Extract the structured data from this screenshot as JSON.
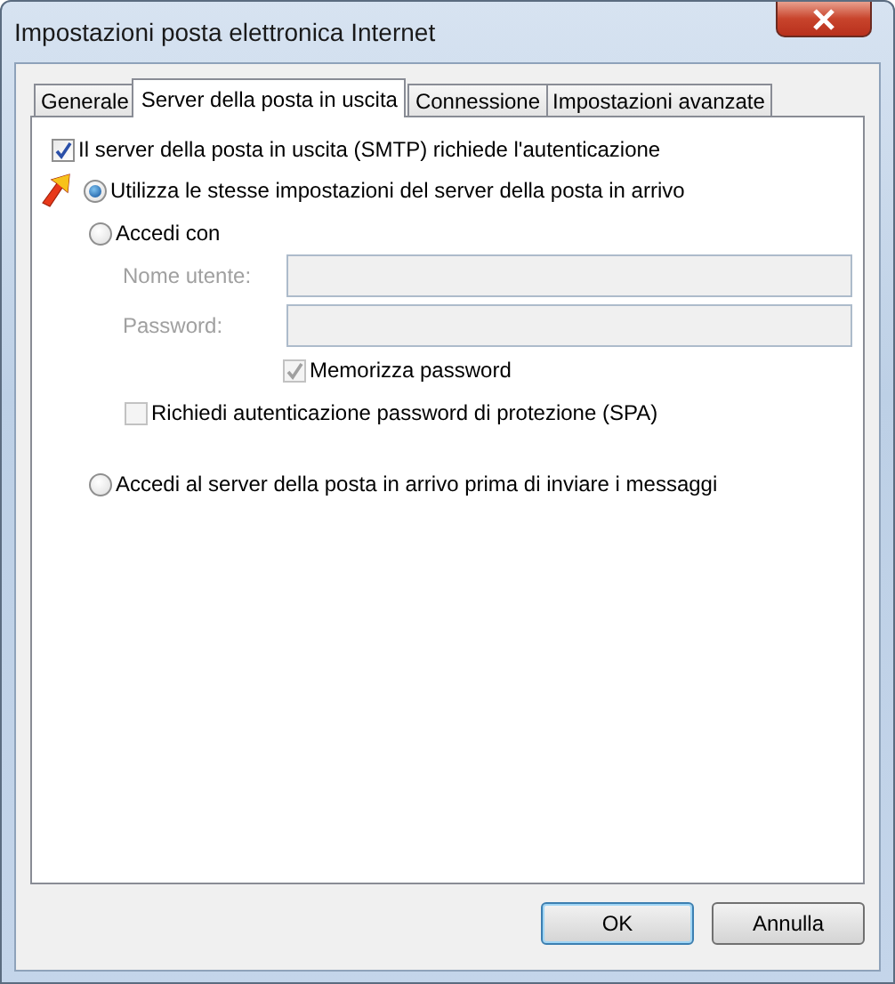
{
  "window": {
    "title": "Impostazioni posta elettronica Internet"
  },
  "tabs": [
    {
      "label": "Generale",
      "selected": false
    },
    {
      "label": "Server della posta in uscita",
      "selected": true
    },
    {
      "label": "Connessione",
      "selected": false
    },
    {
      "label": "Impostazioni avanzate",
      "selected": false
    }
  ],
  "smtp_auth": {
    "label": "Il server della posta in uscita (SMTP) richiede l'autenticazione",
    "checked": true
  },
  "use_same": {
    "label": "Utilizza le stesse impostazioni del server della posta in arrivo",
    "selected": true
  },
  "login_with": {
    "label": "Accedi con",
    "selected": false,
    "fields": [
      {
        "label": "Nome utente:",
        "disabled": true
      },
      {
        "label": "Password:",
        "disabled": true
      }
    ],
    "remember": {
      "label": "Memorizza password",
      "checked": true,
      "disabled": true
    },
    "spa": {
      "label": "Richiedi autenticazione password di protezione (SPA)",
      "checked": false,
      "disabled": true
    }
  },
  "login_before": {
    "label": "Accedi al server della posta in arrivo prima di inviare i messaggi",
    "selected": false
  },
  "buttons": [
    {
      "label": "OK",
      "default": true
    },
    {
      "label": "Annulla",
      "default": false
    }
  ]
}
